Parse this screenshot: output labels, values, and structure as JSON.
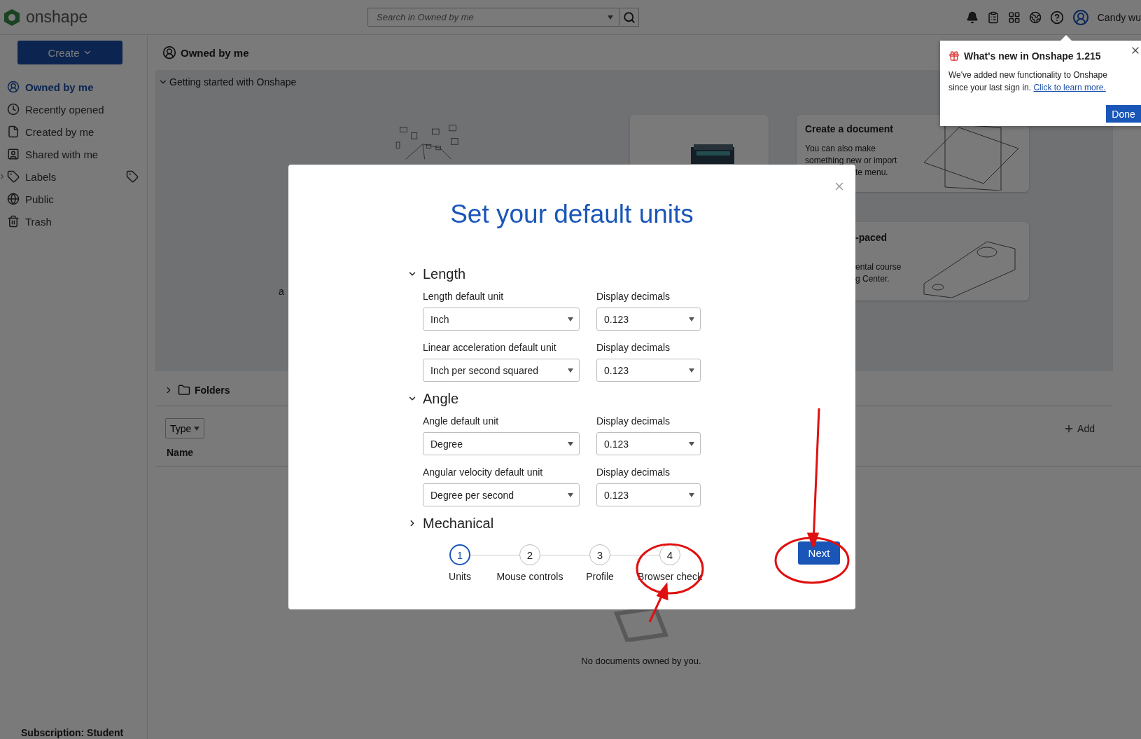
{
  "top_bar": {
    "logo_text": "onshape",
    "search": {
      "placeholder": "Search in Owned by me"
    },
    "user": {
      "name": "Candy wu"
    }
  },
  "sidebar": {
    "create_button": "Create",
    "items": [
      {
        "label": "Owned by me",
        "selected": true,
        "kind": "plain"
      },
      {
        "label": "Recently opened",
        "selected": false,
        "kind": "plain"
      },
      {
        "label": "Created by me",
        "selected": false,
        "kind": "plain"
      },
      {
        "label": "Shared with me",
        "selected": false,
        "kind": "plain"
      },
      {
        "label": "Labels",
        "selected": false,
        "kind": "expandable"
      },
      {
        "label": "Public",
        "selected": false,
        "kind": "plain"
      },
      {
        "label": "Trash",
        "selected": false,
        "kind": "plain"
      }
    ],
    "subscription": "Subscription: Student"
  },
  "main": {
    "header": "Owned by me",
    "getting_started": {
      "title": "Getting started with Onshape",
      "expanded": true,
      "fragment": "a",
      "cards": [
        {
          "title": "Create a document",
          "lines": [
            "You can also make",
            "something new or import",
            "te menu."
          ]
        },
        {
          "title": "-paced",
          "lines": [
            "ental course",
            "g Center."
          ]
        }
      ]
    },
    "folders": {
      "label": "Folders",
      "expanded": false
    },
    "filter": "Type",
    "add": "Add",
    "column": "Name",
    "empty": "No documents owned by you."
  },
  "popover": {
    "title": "What's new in Onshape 1.215",
    "body": "We've added new functionality to Onshape since your last sign in.",
    "link": "Click to learn more.",
    "button": "Done"
  },
  "modal": {
    "title": "Set your default units",
    "sections": [
      {
        "title": "Length",
        "expanded": true,
        "rows": [
          {
            "label": "Length default unit",
            "value": "Inch",
            "decimals_label": "Display decimals",
            "decimals": "0.123"
          },
          {
            "label": "Linear acceleration default unit",
            "value": "Inch per second squared",
            "decimals_label": "Display decimals",
            "decimals": "0.123"
          }
        ]
      },
      {
        "title": "Angle",
        "expanded": true,
        "rows": [
          {
            "label": "Angle default unit",
            "value": "Degree",
            "decimals_label": "Display decimals",
            "decimals": "0.123"
          },
          {
            "label": "Angular velocity default unit",
            "value": "Degree per second",
            "decimals_label": "Display decimals",
            "decimals": "0.123"
          }
        ]
      },
      {
        "title": "Mechanical",
        "expanded": false
      }
    ],
    "steps": [
      {
        "number": "1",
        "label": "Units",
        "selected": true
      },
      {
        "number": "2",
        "label": "Mouse controls",
        "selected": false
      },
      {
        "number": "3",
        "label": "Profile",
        "selected": false
      },
      {
        "number": "4",
        "label": "Browser check",
        "selected": false
      }
    ],
    "next": "Next"
  }
}
